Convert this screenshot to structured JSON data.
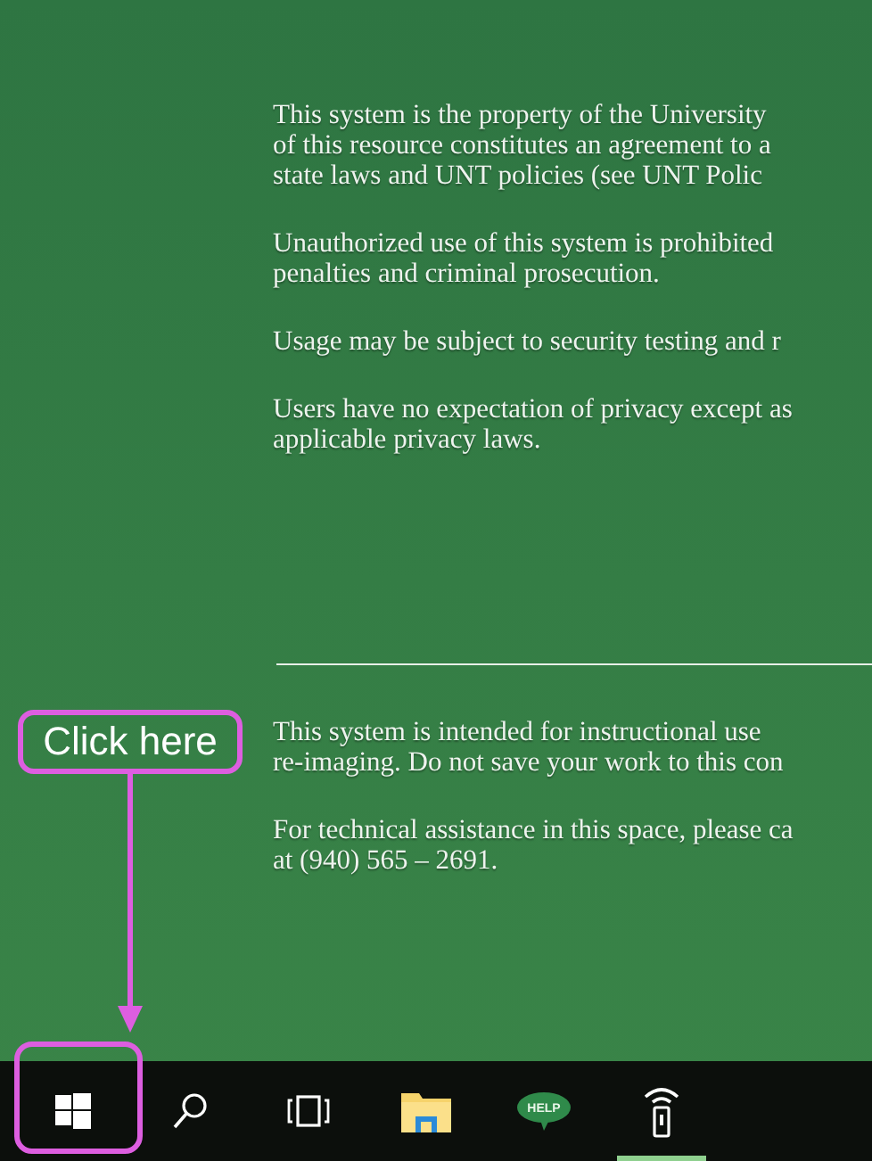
{
  "notice_top": [
    {
      "lines": [
        "This system is the property of the University",
        "of this resource constitutes an agreement to a",
        "state laws and UNT policies (see UNT Polic"
      ]
    },
    {
      "lines": [
        "Unauthorized use of this system is prohibited",
        "penalties and criminal prosecution."
      ]
    },
    {
      "lines": [
        "Usage may be subject to security testing and r"
      ]
    },
    {
      "lines": [
        "Users have no expectation of privacy except as",
        "applicable privacy laws."
      ]
    }
  ],
  "notice_bottom": [
    {
      "lines": [
        "This system is intended for instructional use",
        "re-imaging. Do not save your work to this con"
      ]
    },
    {
      "lines": [
        "For technical assistance in this space, please ca",
        "at (940) 565 – 2691."
      ]
    }
  ],
  "callout": {
    "label": "Click here"
  },
  "taskbar": [
    {
      "kind": "start",
      "highlighted": true,
      "active": false
    },
    {
      "kind": "search",
      "highlighted": false,
      "active": false
    },
    {
      "kind": "taskview",
      "highlighted": false,
      "active": false
    },
    {
      "kind": "folder",
      "highlighted": false,
      "active": false
    },
    {
      "kind": "help",
      "label": "HELP",
      "highlighted": false,
      "active": false
    },
    {
      "kind": "remote",
      "highlighted": false,
      "active": true
    }
  ]
}
